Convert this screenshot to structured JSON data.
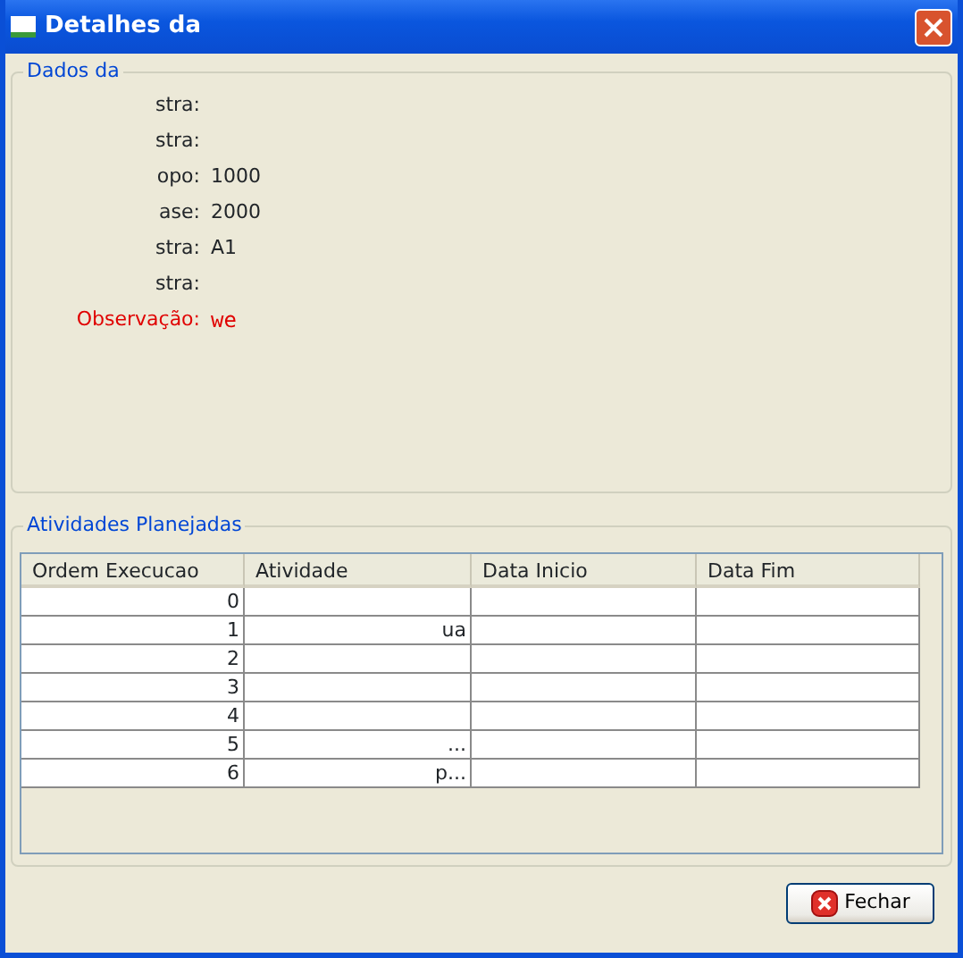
{
  "window": {
    "title": "Detalhes da"
  },
  "dados": {
    "title": "Dados da",
    "fields": [
      {
        "label": "stra:",
        "kind": "plain"
      },
      {
        "label": "stra:",
        "kind": "plain"
      },
      {
        "label": "opo:",
        "value": "1000",
        "kind": "plain"
      },
      {
        "label": "ase:",
        "value": "2000",
        "kind": "plain"
      },
      {
        "label": "stra:",
        "value": "A1",
        "kind": "plain"
      },
      {
        "label": "stra:",
        "kind": "plain"
      },
      {
        "label": "Observação:",
        "value": "we",
        "kind": "note"
      }
    ]
  },
  "atividades": {
    "title": "Atividades Planejadas",
    "columns": [
      "Ordem Execucao",
      "Atividade",
      "Data Inicio",
      "Data Fim"
    ],
    "rows": [
      [
        "0",
        null,
        null,
        null
      ],
      [
        "1",
        "ua",
        null,
        null
      ],
      [
        "2",
        null,
        null,
        null
      ],
      [
        "3",
        null,
        null,
        null
      ],
      [
        "4",
        null,
        null,
        null
      ],
      [
        "5",
        "...",
        null,
        null
      ],
      [
        "6",
        "p...",
        null,
        null
      ]
    ]
  },
  "buttons": [
    {
      "label": "Fechar"
    }
  ]
}
